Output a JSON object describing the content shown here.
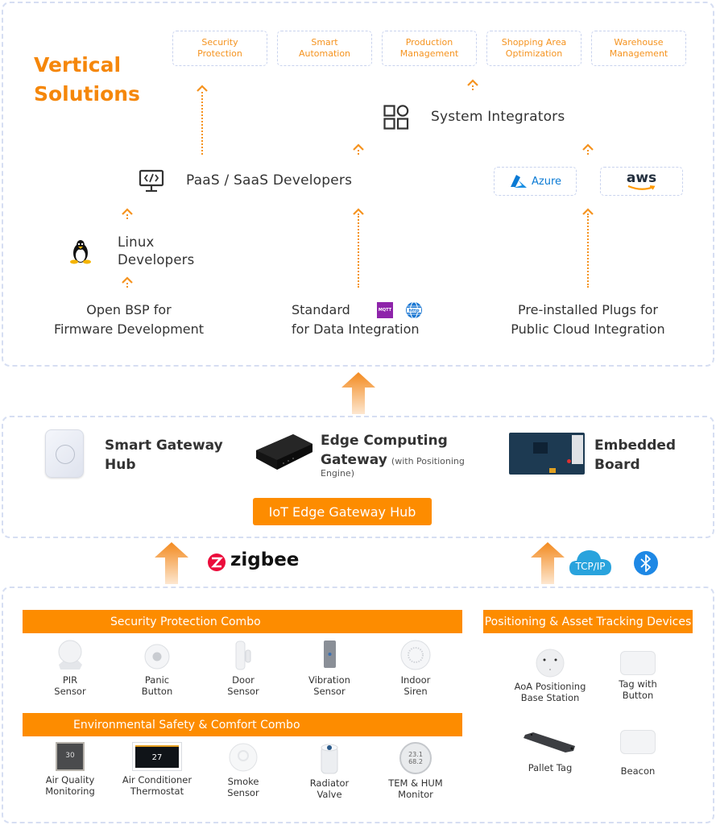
{
  "vertical_solutions": {
    "title_line1": "Vertical",
    "title_line2": "Solutions",
    "items": [
      {
        "line1": "Security",
        "line2": "Protection"
      },
      {
        "line1": "Smart",
        "line2": "Automation"
      },
      {
        "line1": "Production",
        "line2": "Management"
      },
      {
        "line1": "Shopping Area",
        "line2": "Optimization"
      },
      {
        "line1": "Warehouse",
        "line2": "Management"
      }
    ]
  },
  "roles": {
    "system_integrators": "System Integrators",
    "paas_saas": "PaaS / SaaS Developers",
    "linux_line1": "Linux",
    "linux_line2": "Developers"
  },
  "clouds": {
    "azure": "Azure",
    "aws": "aws"
  },
  "foundations": [
    {
      "line1": "Open BSP for",
      "line2": "Firmware Development"
    },
    {
      "line1": "Standard",
      "line2": "for Data Integration"
    },
    {
      "line1": "Pre-installed Plugs for",
      "line2": "Public Cloud Integration"
    }
  ],
  "protocol_badges": {
    "mqtt": "MQTT",
    "http": "http"
  },
  "gateway": {
    "smart_hub_line1": "Smart Gateway",
    "smart_hub_line2": "Hub",
    "edge_line1": "Edge Computing",
    "edge_line2": "Gateway",
    "edge_note_a": "(with Positioning",
    "edge_note_b": "Engine)",
    "embedded_line1": "Embedded",
    "embedded_line2": "Board",
    "label": "IoT Edge Gateway Hub"
  },
  "connectivity": {
    "zigbee": "zigbee",
    "tcpip": "TCP/IP"
  },
  "combos": {
    "security": {
      "title": "Security Protection Combo",
      "devices": [
        {
          "line1": "PIR",
          "line2": "Sensor"
        },
        {
          "line1": "Panic",
          "line2": "Button"
        },
        {
          "line1": "Door",
          "line2": "Sensor"
        },
        {
          "line1": "Vibration",
          "line2": "Sensor"
        },
        {
          "line1": "Indoor",
          "line2": "Siren"
        }
      ]
    },
    "environmental": {
      "title": "Environmental Safety & Comfort Combo",
      "devices": [
        {
          "line1": "Air Quality",
          "line2": "Monitoring",
          "display": "30"
        },
        {
          "line1": "Air Conditioner",
          "line2": "Thermostat",
          "display": "27"
        },
        {
          "line1": "Smoke",
          "line2": "Sensor"
        },
        {
          "line1": "Radiator",
          "line2": "Valve"
        },
        {
          "line1": "TEM & HUM",
          "line2": "Monitor",
          "display_a": "23.1",
          "display_b": "68.2"
        }
      ]
    },
    "positioning": {
      "title": "Positioning & Asset Tracking Devices",
      "devices": [
        {
          "line1": "AoA Positioning",
          "line2": "Base Station"
        },
        {
          "line1": "Tag with",
          "line2": "Button"
        },
        {
          "line1": "Pallet Tag",
          "line2": ""
        },
        {
          "line1": "Beacon",
          "line2": ""
        }
      ]
    }
  },
  "colors": {
    "accent_orange": "#fd8c00",
    "text_orange": "#f5931f",
    "panel_border": "#d6def2",
    "azure_blue": "#0a7ad4",
    "bluetooth_blue": "#1e88e5",
    "tcpip_blue": "#29a3dd",
    "zigbee_red": "#eb0c3b"
  }
}
